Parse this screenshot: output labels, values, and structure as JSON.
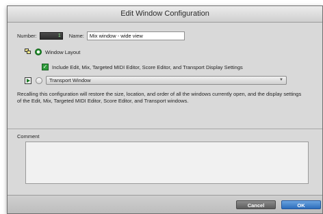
{
  "window": {
    "title": "Edit Window Configuration"
  },
  "config": {
    "number_label": "Number:",
    "number_value": "1",
    "name_label": "Name:",
    "name_value": "Mix window - wide view"
  },
  "options": {
    "window_layout_label": "Window Layout",
    "include_label": "Include Edit, Mix, Targeted MIDI Editor, Score Editor, and Transport Display Settings",
    "transport_selected": "Transport Window"
  },
  "description": "Recalling this configuration will restore the size, location, and order of all the windows currently open, and the display settings of the Edit, Mix, Targeted MIDI Editor, Score Editor, and Transport windows.",
  "comment": {
    "label": "Comment",
    "value": ""
  },
  "buttons": {
    "cancel": "Cancel",
    "ok": "OK"
  },
  "colors": {
    "accent_green": "#1f8a2a",
    "ok_blue": "#2c6dbb"
  }
}
